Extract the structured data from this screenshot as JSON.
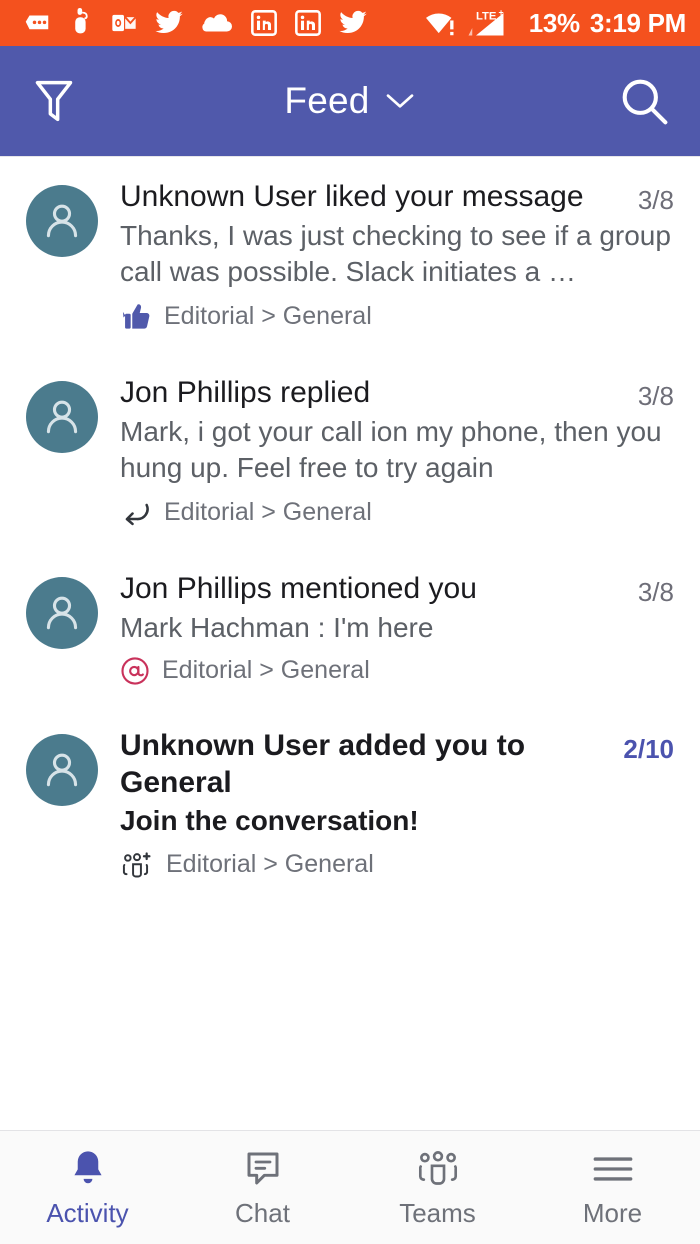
{
  "status_bar": {
    "background_color": "#f4511e",
    "left_icons": [
      {
        "name": "messages-icon",
        "label": "Messages"
      },
      {
        "name": "reminder-hand-icon",
        "label": "Reminder"
      },
      {
        "name": "outlook-icon",
        "label": "Outlook"
      },
      {
        "name": "twitter-icon",
        "label": "Twitter"
      },
      {
        "name": "onedrive-cloud-icon",
        "label": "OneDrive"
      },
      {
        "name": "linkedin-icon",
        "label": "LinkedIn"
      },
      {
        "name": "linkedin-icon",
        "label": "LinkedIn"
      },
      {
        "name": "twitter-icon",
        "label": "Twitter"
      }
    ],
    "wifi_icon": "wifi-warning-icon",
    "network_type": "LTE",
    "network_superscript": "+",
    "signal_icon": "signal-bars-icon",
    "battery_percent": "13%",
    "time": "3:19 PM"
  },
  "header": {
    "background_color": "#5059ab",
    "filter_icon": "filter-funnel-icon",
    "title": "Feed",
    "chevron_icon": "chevron-down-icon",
    "search_icon": "search-icon"
  },
  "feed": {
    "items": [
      {
        "avatar_icon": "person-avatar-icon",
        "avatar_color": "#4b7b8d",
        "title": "Unknown User liked your message",
        "date": "3/8",
        "preview": "Thanks, I was just checking to see if a group call was possible. Slack initiates a …",
        "meta_icon": "thumbs-up-icon",
        "meta_icon_color": "#5059ab",
        "breadcrumb": "Editorial > General",
        "unread": false
      },
      {
        "avatar_icon": "person-avatar-icon",
        "avatar_color": "#4b7b8d",
        "title": "Jon Phillips replied",
        "date": "3/8",
        "preview": "Mark, i got your call ion my phone, then you hung up. Feel free to try again",
        "meta_icon": "reply-arrow-icon",
        "meta_icon_color": "#32363c",
        "breadcrumb": "Editorial > General",
        "unread": false
      },
      {
        "avatar_icon": "person-avatar-icon",
        "avatar_color": "#4b7b8d",
        "title": "Jon Phillips mentioned you",
        "date": "3/8",
        "preview": "Mark Hachman : I'm here",
        "meta_icon": "at-mention-icon",
        "meta_icon_color": "#c9325b",
        "breadcrumb": "Editorial > General",
        "unread": false
      },
      {
        "avatar_icon": "person-avatar-icon",
        "avatar_color": "#4b7b8d",
        "title": "Unknown User added you to General",
        "date": "2/10",
        "preview": "Join the conversation!",
        "meta_icon": "add-people-icon",
        "meta_icon_color": "#32363c",
        "breadcrumb": "Editorial > General",
        "unread": true
      }
    ]
  },
  "bottom_nav": {
    "active_color": "#4b53ae",
    "inactive_color": "#6e7179",
    "items": [
      {
        "label": "Activity",
        "icon": "bell-icon",
        "active": true
      },
      {
        "label": "Chat",
        "icon": "chat-bubble-icon",
        "active": false
      },
      {
        "label": "Teams",
        "icon": "teams-people-icon",
        "active": false
      },
      {
        "label": "More",
        "icon": "hamburger-menu-icon",
        "active": false
      }
    ]
  }
}
